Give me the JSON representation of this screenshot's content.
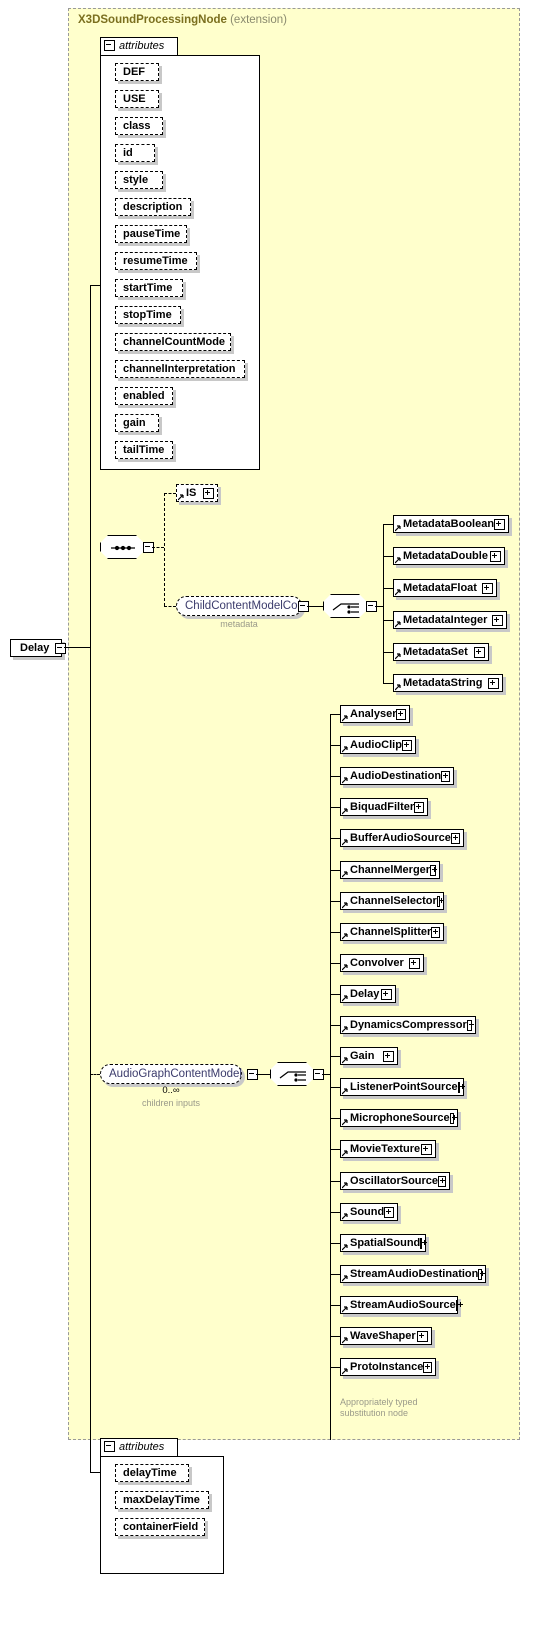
{
  "diagram": {
    "type": "xsd-schema-diagram",
    "root_element": "Delay",
    "extension": {
      "base_type": "X3DSoundProcessingNode",
      "kind_label": "(extension)"
    },
    "colors": {
      "extension_fill": "#ffffcc",
      "extension_border": "#999999",
      "box_fill": "#ffffff",
      "shadow": "#c8c8c8",
      "group_ref_text": "#3b3b6b",
      "caption_text": "#9a9a8a",
      "title_text": "#7b6f1f"
    }
  },
  "root": {
    "label": "Delay",
    "toggle": "minus"
  },
  "inherited_attributes": {
    "group_label": "attributes",
    "toggle": "minus",
    "items": [
      "DEF",
      "USE",
      "class",
      "id",
      "style",
      "description",
      "pauseTime",
      "resumeTime",
      "startTime",
      "stopTime",
      "channelCountMode",
      "channelInterpretation",
      "enabled",
      "gain",
      "tailTime"
    ]
  },
  "sequence": {
    "compositor": "sequence",
    "toggle": "minus"
  },
  "content_branches": {
    "is_element": {
      "label": "IS",
      "toggle": "plus"
    },
    "child_content_model_core": {
      "label": "ChildContentModelCore",
      "caption": "metadata",
      "toggle": "minus",
      "compositor": "choice",
      "compositor_toggle": "minus",
      "children": [
        "MetadataBoolean",
        "MetadataDouble",
        "MetadataFloat",
        "MetadataInteger",
        "MetadataSet",
        "MetadataString"
      ]
    },
    "audio_graph_content_model": {
      "label": "AudioGraphContentModel",
      "occurs": "0..∞",
      "caption": "children inputs",
      "toggle": "minus",
      "compositor": "choice",
      "compositor_toggle": "minus",
      "children": [
        "Analyser",
        "AudioClip",
        "AudioDestination",
        "BiquadFilter",
        "BufferAudioSource",
        "ChannelMerger",
        "ChannelSelector",
        "ChannelSplitter",
        "Convolver",
        "Delay",
        "DynamicsCompressor",
        "Gain",
        "ListenerPointSource",
        "MicrophoneSource",
        "MovieTexture",
        "OscillatorSource",
        "Sound",
        "SpatialSound",
        "StreamAudioDestination",
        "StreamAudioSource",
        "WaveShaper",
        "ProtoInstance"
      ],
      "last_child_caption": "Appropriately typed\nsubstitution node"
    }
  },
  "own_attributes": {
    "group_label": "attributes",
    "toggle": "minus",
    "items": [
      "delayTime",
      "maxDelayTime",
      "containerField"
    ]
  }
}
